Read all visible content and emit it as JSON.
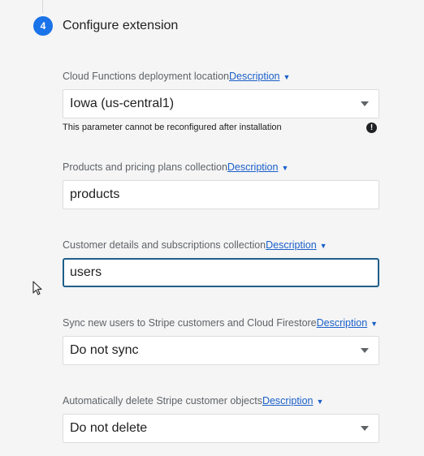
{
  "step": {
    "number": "4",
    "title": "Configure extension"
  },
  "fields": [
    {
      "label": "Cloud Functions deployment location",
      "link": "Description",
      "type": "select",
      "value": "Iowa (us-central1)",
      "hint": "This parameter cannot be reconfigured after installation"
    },
    {
      "label": "Products and pricing plans collection",
      "link": "Description",
      "type": "input",
      "value": "products"
    },
    {
      "label": "Customer details and subscriptions collection",
      "link": "Description",
      "type": "input",
      "value": "users",
      "focused": true
    },
    {
      "label": "Sync new users to Stripe customers and Cloud Firestore",
      "link": "Description",
      "type": "select",
      "value": "Do not sync"
    },
    {
      "label": "Automatically delete Stripe customer objects",
      "link": "Description",
      "type": "select",
      "value": "Do not delete"
    }
  ],
  "colors": {
    "accent": "#1a73e8",
    "link": "#1a5fc9",
    "focus_border": "#1f5f8a"
  },
  "icons": {
    "caret": "caret-down-icon",
    "dropdown": "dropdown-arrow-icon",
    "info": "info-icon",
    "cursor": "mouse-pointer-icon"
  }
}
